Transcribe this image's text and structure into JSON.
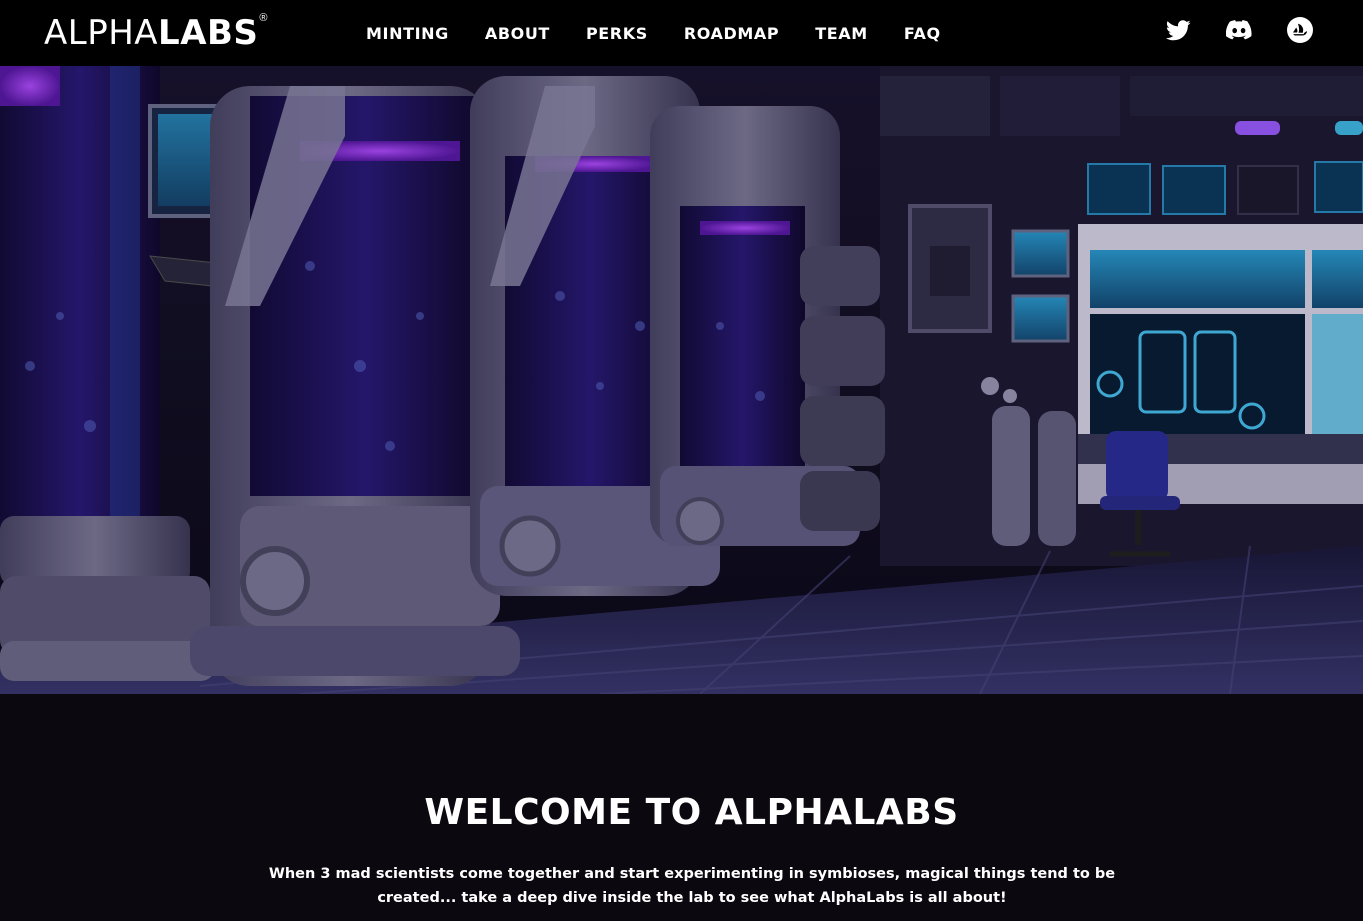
{
  "brand": {
    "logo_part1": "ALPHA",
    "logo_part2": "LABS",
    "registered_mark": "®"
  },
  "nav": {
    "items": [
      {
        "label": "MINTING"
      },
      {
        "label": "ABOUT"
      },
      {
        "label": "PERKS"
      },
      {
        "label": "ROADMAP"
      },
      {
        "label": "TEAM"
      },
      {
        "label": "FAQ"
      }
    ]
  },
  "socials": [
    {
      "icon": "twitter-icon"
    },
    {
      "icon": "discord-icon"
    },
    {
      "icon": "opensea-icon"
    }
  ],
  "hero": {
    "image": "sci-fi laboratory with stasis tubes and control consoles"
  },
  "welcome": {
    "title": "WELCOME TO ALPHALABS",
    "text": "When 3 mad scientists come together and start experimenting in symbioses, magical things tend to be created... take a deep dive inside the lab to see what AlphaLabs is all about!"
  },
  "colors": {
    "nav_bg": "#000000",
    "page_bg": "#0b080f",
    "accent_purple": "#8b3cff",
    "accent_cyan": "#3fb8e6"
  }
}
